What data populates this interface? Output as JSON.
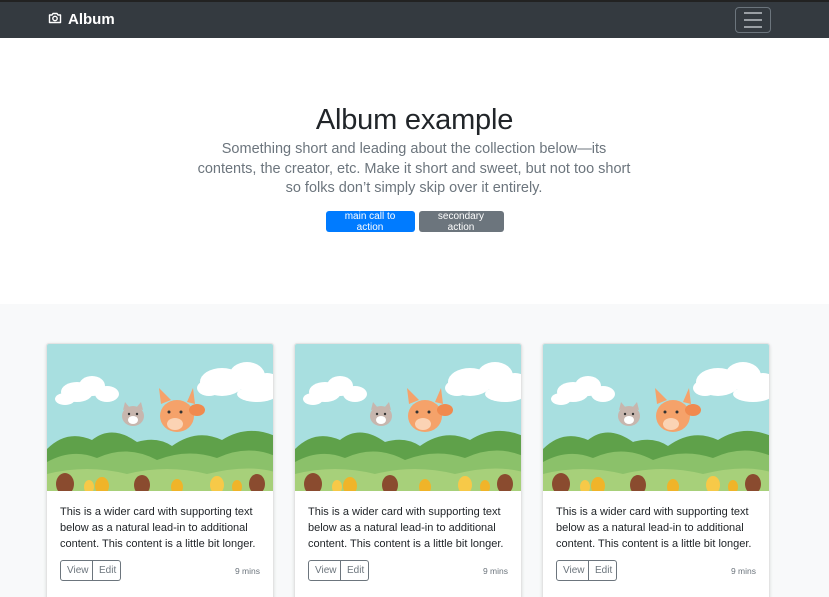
{
  "navbar": {
    "brand": "Album",
    "brand_icon": "camera-icon",
    "toggler_icon": "hamburger-icon"
  },
  "hero": {
    "title": "Album example",
    "lead": "Something short and leading about the collection below—its contents, the creator, etc. Make it short and sweet, but not too short so folks don’t simply skip over it entirely.",
    "primary_button": "main call to action",
    "secondary_button": "secondary action"
  },
  "cards": [
    {
      "text": "This is a wider card with supporting text below as a natural lead-in to additional content. This content is a little bit longer.",
      "view_label": "View",
      "edit_label": "Edit",
      "time": "9 mins"
    },
    {
      "text": "This is a wider card with supporting text below as a natural lead-in to additional content. This content is a little bit longer.",
      "view_label": "View",
      "edit_label": "Edit",
      "time": "9 mins"
    },
    {
      "text": "This is a wider card with supporting text below as a natural lead-in to additional content. This content is a little bit longer.",
      "view_label": "View",
      "edit_label": "Edit",
      "time": "9 mins"
    }
  ],
  "colors": {
    "navbar": "#343a40",
    "primary": "#007bff",
    "secondary": "#6c757d",
    "album_bg": "#f8f9fa"
  }
}
